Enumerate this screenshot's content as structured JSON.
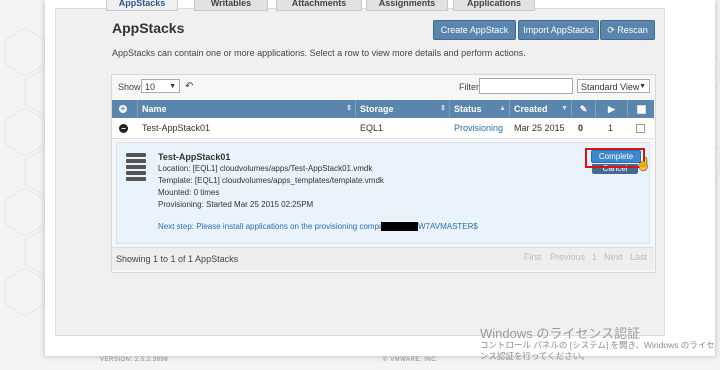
{
  "tabs": [
    "AppStacks",
    "Writables",
    "Attachments",
    "Assignments",
    "Applications"
  ],
  "title": "AppStacks",
  "buttons": {
    "create": "Create AppStack",
    "import": "Import AppStacks",
    "rescan": "Rescan"
  },
  "description": "AppStacks can contain one or more applications. Select a row to view more details and perform actions.",
  "controls": {
    "show_label": "Show",
    "show_value": "10",
    "filter_label": "Filter",
    "filter_value": "",
    "view": "Standard View"
  },
  "columns": {
    "name": "Name",
    "storage": "Storage",
    "status": "Status",
    "created": "Created"
  },
  "row": {
    "name": "Test-AppStack01",
    "storage": "EQL1",
    "status": "Provisioning",
    "created": "Mar 25 2015",
    "col_attach": "0",
    "col_count": "1"
  },
  "detail": {
    "name": "Test-AppStack01",
    "location": "Location: [EQL1] cloudvolumes/apps/Test-AppStack01.vmdk",
    "template": "Template: [EQL1] cloudvolumes/apps_templates/template.vmdk",
    "mounted": "Mounted: 0 times",
    "provisioning": "Provisioning: Started Mar 25 2015 02:25PM",
    "next_step": "Next step: Please install applications on the provisioning computer:",
    "computer": "W7AVMASTER$",
    "complete": "Complete",
    "cancel": "Cancel"
  },
  "footer": {
    "showing": "Showing 1 to 1 of 1 AppStacks",
    "first": "First",
    "previous": "Previous",
    "page": "1",
    "next": "Next",
    "last": "Last"
  },
  "watermark": {
    "line1": "Windows のライセンス認証",
    "line2": "コントロール パネルの [システム] を開き、Windows のライセンス認証を行ってください。"
  },
  "version": "VERSION: 2.5.2.3898",
  "copyright": "© VMWARE, INC.",
  "colors": {
    "header_blue": "#5a85ad",
    "highlight": "#d11111",
    "detail_bg": "#eaf3fb"
  }
}
